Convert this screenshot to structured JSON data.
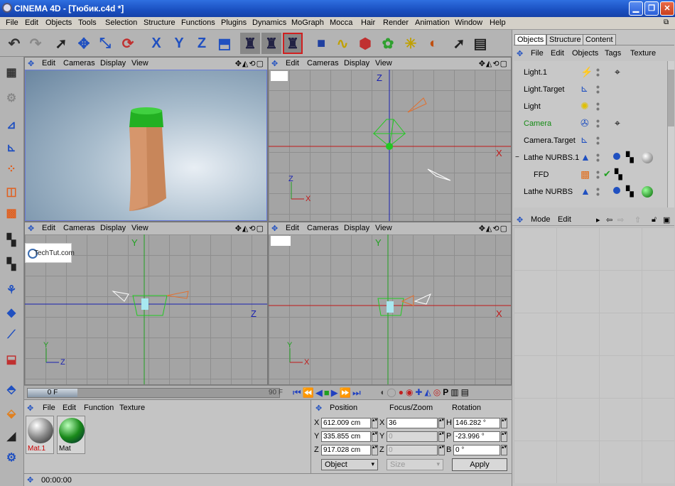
{
  "window": {
    "title": "CINEMA 4D - [Тюбик.c4d *]"
  },
  "menu": [
    "File",
    "Edit",
    "Objects",
    "Tools",
    "Selection",
    "Structure",
    "Functions",
    "Plugins",
    "Dynamics",
    "MoGraph",
    "Mocca",
    "Hair",
    "Render",
    "Animation",
    "Window",
    "Help"
  ],
  "viewport_menu": {
    "edit": "Edit",
    "cameras": "Cameras",
    "display": "Display",
    "view": "View"
  },
  "axes": {
    "x": "X",
    "y": "Y",
    "z": "Z"
  },
  "watermark": "TechTut.com",
  "objects_panel": {
    "tabs": [
      "Objects",
      "Structure",
      "Content"
    ],
    "menu": [
      "File",
      "Edit",
      "Objects",
      "Tags",
      "Texture"
    ],
    "items": [
      {
        "name": "Light.1",
        "color": "#000000"
      },
      {
        "name": "Light.Target",
        "color": "#000000"
      },
      {
        "name": "Light",
        "color": "#000000"
      },
      {
        "name": "Camera",
        "color": "#138a13"
      },
      {
        "name": "Camera.Target",
        "color": "#000000"
      },
      {
        "name": "Lathe NURBS.1",
        "color": "#000000",
        "expander": "−"
      },
      {
        "name": "FFD",
        "color": "#000000"
      },
      {
        "name": "Lathe NURBS",
        "color": "#000000"
      }
    ]
  },
  "attributes_panel": {
    "mode": "Mode",
    "edit": "Edit"
  },
  "timeline": {
    "current": "0 F",
    "end": "90 F"
  },
  "materials": {
    "menu": [
      "File",
      "Edit",
      "Function",
      "Texture"
    ],
    "items": [
      {
        "name": "Mat.1",
        "color": "#cc0000"
      },
      {
        "name": "Mat",
        "color": "#000000"
      }
    ]
  },
  "coords": {
    "headers": {
      "position": "Position",
      "focus": "Focus/Zoom",
      "rotation": "Rotation"
    },
    "pos": {
      "x": "612.009 cm",
      "y": "335.855 cm",
      "z": "917.028 cm"
    },
    "focus": {
      "x": "36",
      "y": "0",
      "z": "0"
    },
    "rot": {
      "h": "146.282 °",
      "p": "-23.996 °",
      "b": "0 °"
    },
    "labels": {
      "x": "X",
      "y": "Y",
      "z": "Z",
      "h": "H",
      "p": "P",
      "b": "B"
    },
    "mode_select": "Object",
    "size_select": "Size",
    "apply": "Apply"
  },
  "status": {
    "time": "00:00:00"
  },
  "colors": {
    "title_blue": "#1a4fc0",
    "axis_green": "#20a020",
    "axis_red": "#c01818",
    "axis_blue": "#1820b0",
    "wire_green": "#22c822"
  }
}
